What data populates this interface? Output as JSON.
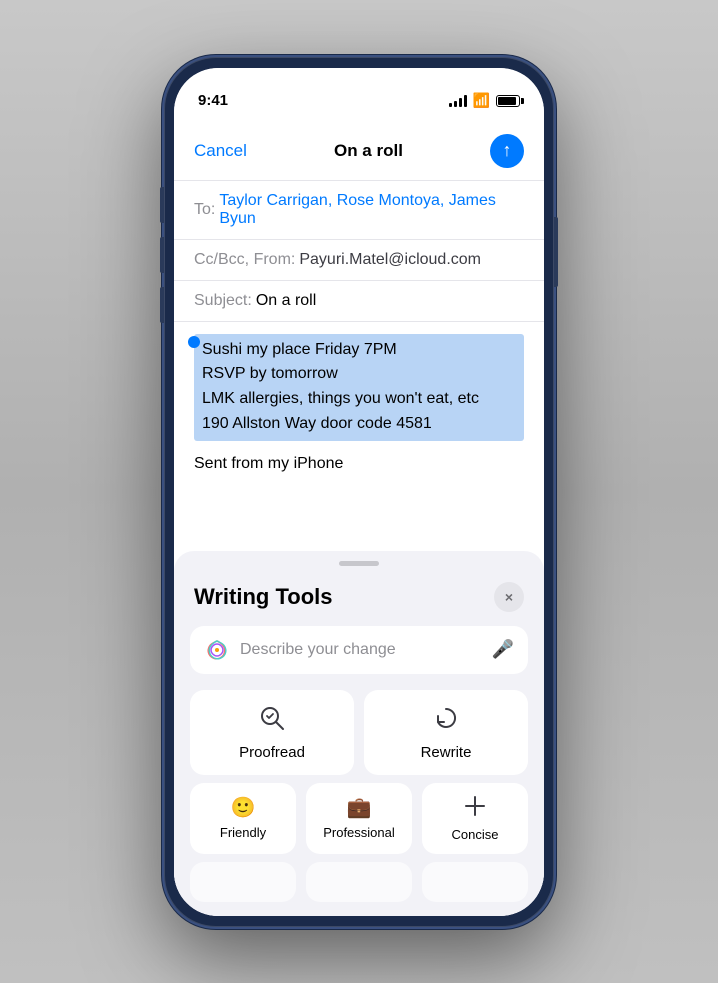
{
  "status_bar": {
    "time": "9:41",
    "signal": "signal-icon",
    "wifi": "wifi-icon",
    "battery": "battery-icon"
  },
  "nav": {
    "cancel": "Cancel",
    "title": "On a roll",
    "send": "send-icon"
  },
  "email": {
    "to_label": "To:",
    "to_value": "Taylor Carrigan, Rose Montoya, James Byun",
    "cc_label": "Cc/Bcc, From:",
    "cc_value": "Payuri.Matel@icloud.com",
    "subject_label": "Subject:",
    "subject_value": "On a roll",
    "body_lines": [
      "Sushi my place Friday 7PM",
      "RSVP by tomorrow",
      "LMK allergies, things you won't eat, etc",
      "190 Allston Way door code 4581"
    ],
    "signature": "Sent from my iPhone"
  },
  "writing_tools": {
    "title": "Writing Tools",
    "close_label": "×",
    "search_placeholder": "Describe your change",
    "buttons": [
      {
        "icon": "proofread-icon",
        "label": "Proofread"
      },
      {
        "icon": "rewrite-icon",
        "label": "Rewrite"
      }
    ],
    "row3": [
      {
        "icon": "friendly-icon",
        "label": "Friendly"
      },
      {
        "icon": "professional-icon",
        "label": "Professional"
      },
      {
        "icon": "concise-icon",
        "label": "Concise"
      }
    ]
  }
}
